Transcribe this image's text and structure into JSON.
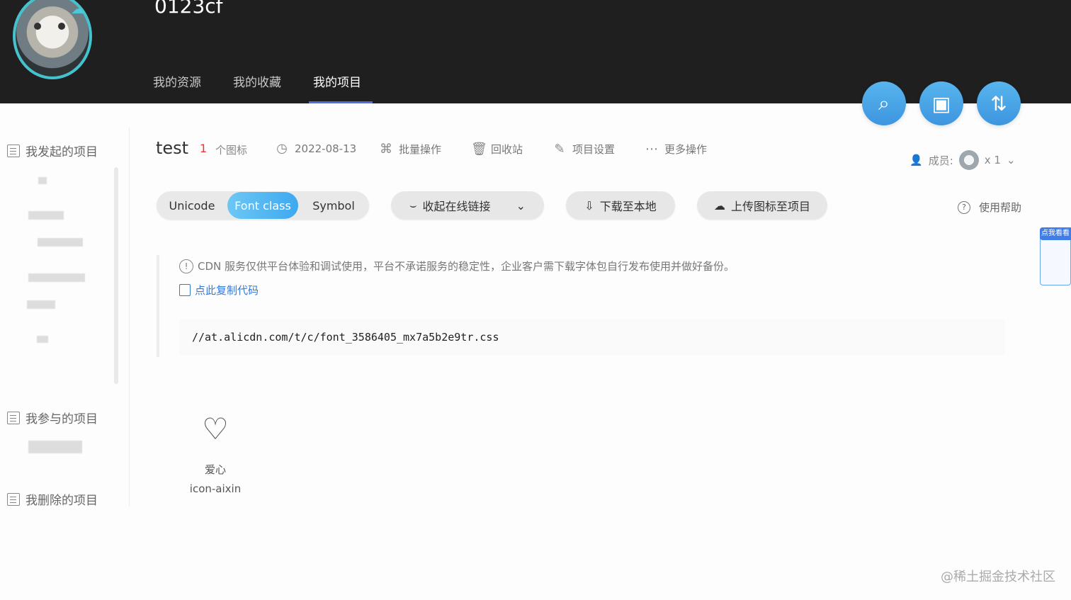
{
  "header": {
    "username": "0123cf",
    "tabs": [
      "我的资源",
      "我的收藏",
      "我的项目"
    ]
  },
  "sidebar": {
    "sections": [
      "我发起的项目",
      "我参与的项目",
      "我删除的项目"
    ]
  },
  "project": {
    "name": "test",
    "count": "1",
    "count_label": "个图标",
    "date": "2022-08-13",
    "batch": "批量操作",
    "recycle": "回收站",
    "settings": "项目设置",
    "more": "更多操作",
    "members_label": "成员:",
    "members_count": "x 1"
  },
  "toolbar": {
    "unicode": "Unicode",
    "font_class": "Font class",
    "symbol": "Symbol",
    "collapse_link": "收起在线链接",
    "download": "下载至本地",
    "upload": "上传图标至项目",
    "help": "使用帮助"
  },
  "notice": {
    "text": "CDN 服务仅供平台体验和调试使用，平台不承诺服务的稳定性，企业客户需下载字体包自行发布使用并做好备份。",
    "copy": "点此复制代码",
    "code": "//at.alicdn.com/t/c/font_3586405_mx7a5b2e9tr.css"
  },
  "icon": {
    "name": "爱心",
    "code": "icon-aixin"
  },
  "watermark": "@稀土掘金技术社区",
  "floating_tag": "点我看看"
}
